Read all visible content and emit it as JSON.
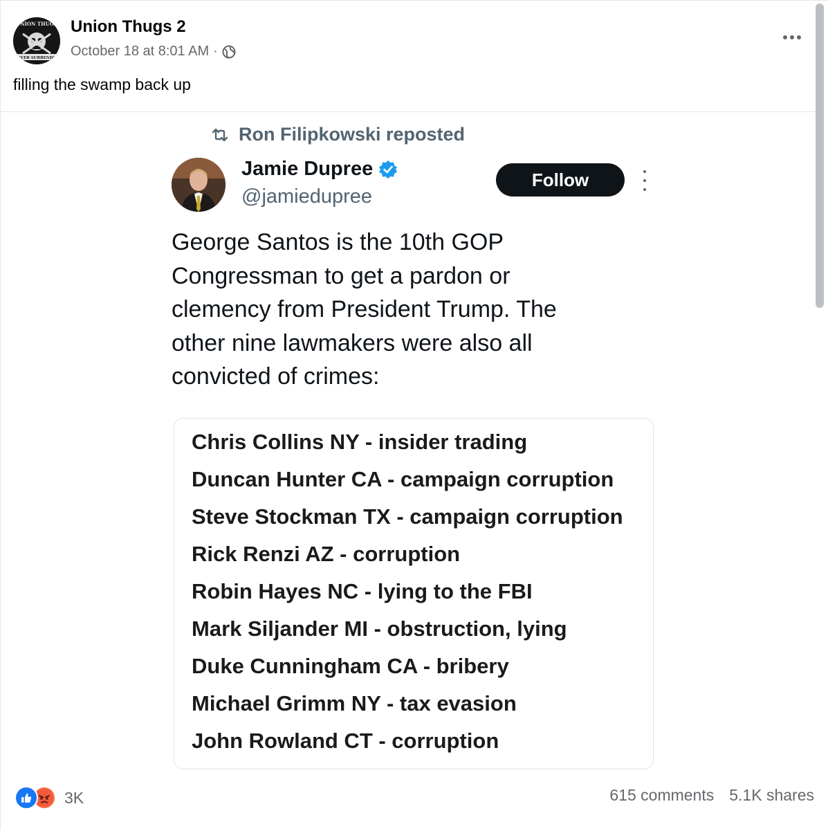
{
  "post": {
    "page_name": "Union Thugs 2",
    "date": "October 18 at 8:01 AM",
    "separator": "·",
    "caption": "filling the swamp back up",
    "avatar_text_top": "UNION THUGS",
    "avatar_text_bottom": "NEVER SURRENDER"
  },
  "embed": {
    "reposted_by": "Ron Filipkowski reposted",
    "author_name": "Jamie Dupree",
    "author_handle": "@jamiedupree",
    "follow_label": "Follow",
    "tweet_text": "George Santos is the 10th GOP\nCongressman to get a pardon or\nclemency from President Trump.  The\nother nine lawmakers were also all\nconvicted of crimes:",
    "list": [
      "Chris Collins NY - insider trading",
      "Duncan Hunter CA - campaign corruption",
      "Steve Stockman TX - campaign corruption",
      "Rick Renzi AZ - corruption",
      "Robin Hayes NC - lying to the FBI",
      "Mark Siljander MI - obstruction, lying",
      "Duke Cunningham CA - bribery",
      "Michael Grimm NY - tax evasion",
      "John Rowland CT - corruption"
    ]
  },
  "footer": {
    "reaction_count": "3K",
    "comments": "615 comments",
    "shares": "5.1K shares"
  },
  "icons": {
    "globe": "globe-icon",
    "more": "more-options-icon",
    "repost": "repost-icon",
    "verified": "verified-badge-icon",
    "like": "like-reaction-icon",
    "angry": "angry-reaction-icon"
  },
  "colors": {
    "secondary_text": "#65676b",
    "twitter_gray": "#536471",
    "verified_blue": "#1d9bf0",
    "like_blue": "#1877f2",
    "angry_orange": "#f7714c",
    "follow_button": "#0f1419"
  }
}
